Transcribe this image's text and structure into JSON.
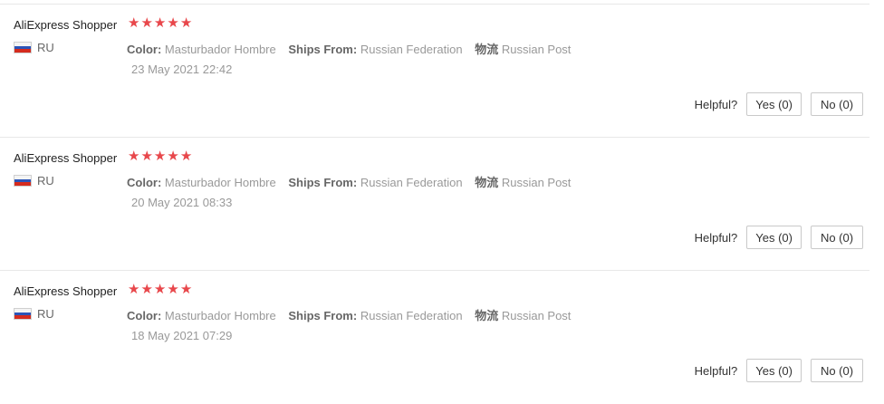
{
  "reviews": [
    {
      "user": "AliExpress Shopper",
      "rating": 5,
      "country": "RU",
      "color_label": "Color:",
      "color_value": "Masturbador Hombre",
      "ships_label": "Ships From:",
      "ships_value": "Russian Federation",
      "logistics_label": "物流",
      "logistics_value": "Russian Post",
      "date": "23 May 2021 22:42",
      "helpful_label": "Helpful?",
      "yes_label": "Yes (0)",
      "no_label": "No (0)"
    },
    {
      "user": "AliExpress Shopper",
      "rating": 5,
      "country": "RU",
      "color_label": "Color:",
      "color_value": "Masturbador Hombre",
      "ships_label": "Ships From:",
      "ships_value": "Russian Federation",
      "logistics_label": "物流",
      "logistics_value": "Russian Post",
      "date": "20 May 2021 08:33",
      "helpful_label": "Helpful?",
      "yes_label": "Yes (0)",
      "no_label": "No (0)"
    },
    {
      "user": "AliExpress Shopper",
      "rating": 5,
      "country": "RU",
      "color_label": "Color:",
      "color_value": "Masturbador Hombre",
      "ships_label": "Ships From:",
      "ships_value": "Russian Federation",
      "logistics_label": "物流",
      "logistics_value": "Russian Post",
      "date": "18 May 2021 07:29",
      "helpful_label": "Helpful?",
      "yes_label": "Yes (0)",
      "no_label": "No (0)"
    }
  ],
  "colors": {
    "star": "#e8474b",
    "divider": "#e8e8e8"
  },
  "icons": {
    "star": "star-icon",
    "flag": "russia-flag-icon"
  }
}
